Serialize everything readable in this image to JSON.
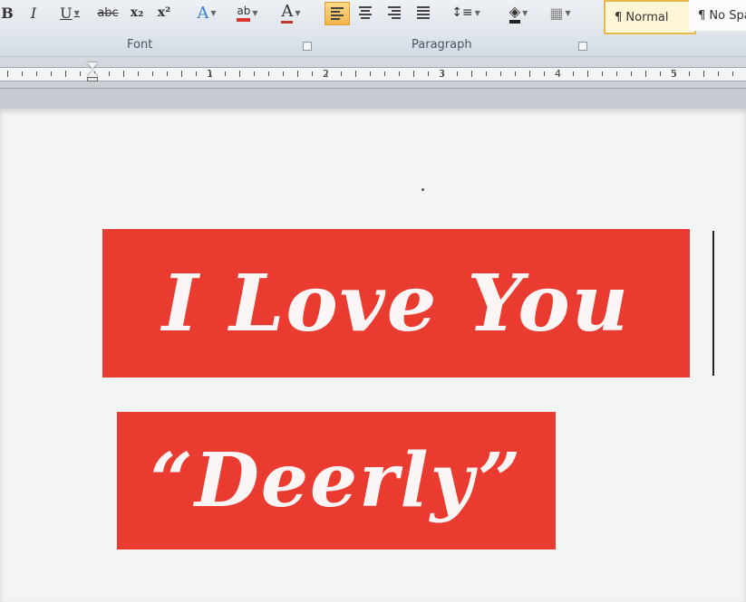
{
  "ribbon": {
    "font_group": {
      "label": "Font",
      "buttons": [
        {
          "name": "bold-button",
          "label": "B"
        },
        {
          "name": "italic-button",
          "label": "I"
        },
        {
          "name": "underline-button",
          "label": "U"
        },
        {
          "name": "strikethrough-button",
          "label": "abc"
        },
        {
          "name": "subscript-button",
          "label": "x₂"
        },
        {
          "name": "superscript-button",
          "label": "x²"
        },
        {
          "name": "text-effects-button",
          "label": "A"
        },
        {
          "name": "highlight-color-button",
          "label": "ab"
        },
        {
          "name": "font-color-button",
          "label": "A"
        }
      ]
    },
    "paragraph_group": {
      "label": "Paragraph"
    },
    "styles": [
      {
        "label": "¶ Normal",
        "active": true
      },
      {
        "label": "¶ No Spa",
        "active": false
      }
    ],
    "colors": {
      "accent_orange": "#f2b54b",
      "highlight_red": "#d9342b",
      "font_color": "#c0392b"
    }
  },
  "ruler": {
    "numbers": [
      "1",
      "2",
      "3",
      "4",
      "5"
    ]
  },
  "document": {
    "line1": "I Love You",
    "line2": "“Deerly”",
    "banner_color": "#ea3b30",
    "text_color": "#fbf6f5"
  }
}
